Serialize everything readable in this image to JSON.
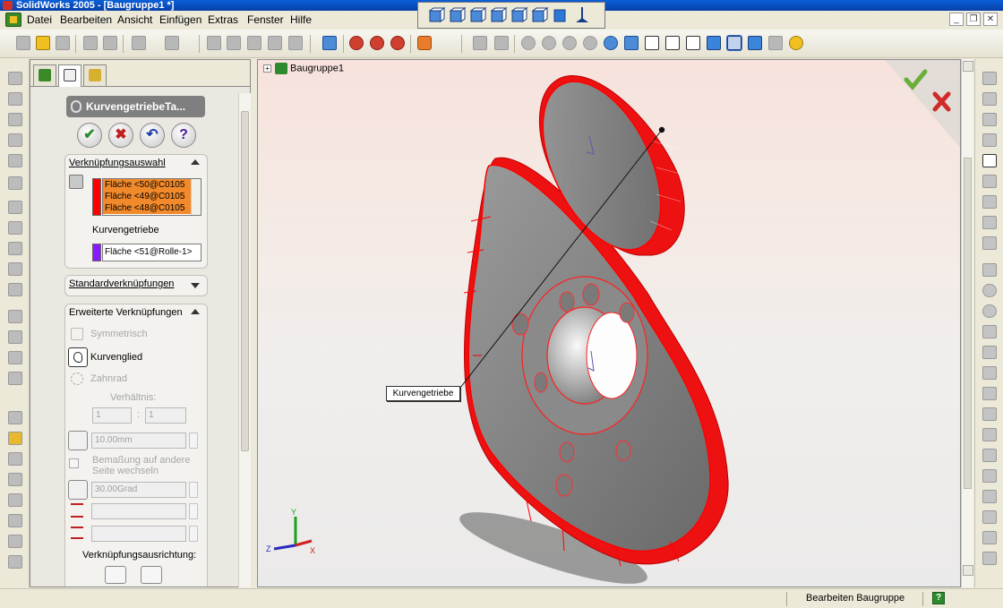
{
  "window": {
    "title": "SolidWorks 2005 - [Baugruppe1 *]"
  },
  "menu": [
    {
      "label": "Datei"
    },
    {
      "label": "Bearbeiten"
    },
    {
      "label": "Ansicht"
    },
    {
      "label": "Einfügen"
    },
    {
      "label": "Extras"
    },
    {
      "label": "Fenster"
    },
    {
      "label": "Hilfe"
    }
  ],
  "property_manager": {
    "title": "KurvengetriebeTa...",
    "buttons": {
      "ok": "✔",
      "cancel": "✖",
      "undo": "↶",
      "help": "?"
    },
    "mate_selection": {
      "header": "Verknüpfungsauswahl",
      "faces": [
        "Fläche <50@C0105",
        "Fläche <49@C0105",
        "Fläche <48@C0105"
      ],
      "cam_label": "Kurvengetriebe",
      "cam_face": "Fläche <51@Rolle-1>"
    },
    "standard_mates": {
      "header": "Standardverknüpfungen"
    },
    "advanced_mates": {
      "header": "Erweiterte Verknüpfungen",
      "symmetric": "Symmetrisch",
      "cam": "Kurvenglied",
      "gear": "Zahnrad",
      "ratio_label": "Verhältnis:",
      "ratio_left": "1",
      "ratio_sep": ":",
      "ratio_right": "1",
      "distance": "10.00mm",
      "flip_line1": "Bemaßung auf andere",
      "flip_line2": "Seite wechseln",
      "angle": "30.00Grad",
      "alignment_label": "Verknüpfungsausrichtung:"
    }
  },
  "viewport": {
    "tree_root": "Baugruppe1",
    "callout": "Kurvengetriebe",
    "triad": {
      "x": "X",
      "y": "Y",
      "z": "Z"
    }
  },
  "statusbar": {
    "text": "Bearbeiten Baugruppe",
    "help": "?"
  },
  "colors": {
    "selection_red": "#ff0000",
    "selection_orange": "#f28a2c",
    "purple": "#8a1aff",
    "accept_green": "#6aae3a",
    "reject_red": "#d02a2a"
  }
}
